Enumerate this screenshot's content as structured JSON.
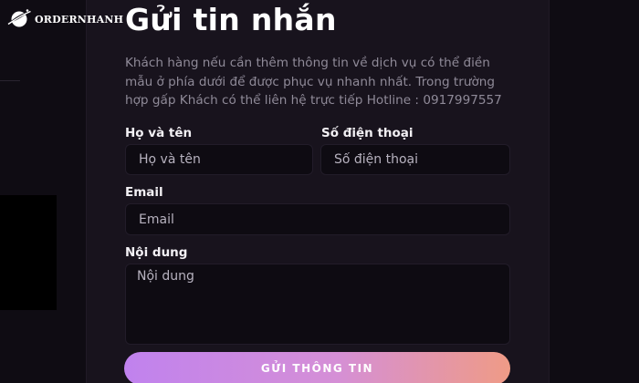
{
  "brand": {
    "name": "ORDERNHANH",
    "logo_icon": "planet-orbit-icon"
  },
  "form": {
    "title": "Gửi tin nhắn",
    "description": "Khách hàng nếu cần thêm thông tin về dịch vụ có thể điền mẫu ở phía dưới để được phục vụ nhanh nhất. Trong trường hợp gấp Khách có thể liên hệ trực tiếp Hotline : 0917997557",
    "fields": {
      "name": {
        "label": "Họ và tên",
        "placeholder": "Họ và tên",
        "value": ""
      },
      "phone": {
        "label": "Số điện thoại",
        "placeholder": "Số điện thoại",
        "value": ""
      },
      "email": {
        "label": "Email",
        "placeholder": "Email",
        "value": ""
      },
      "message": {
        "label": "Nội dung",
        "placeholder": "Nội dung",
        "value": ""
      }
    },
    "submit_label": "GỬI THÔNG TIN"
  },
  "colors": {
    "background": "#0f0c13",
    "panel": "#18131d",
    "input_bg": "#0e0b12",
    "button_gradient_start": "#c082ee",
    "button_gradient_end": "#ef9b86"
  }
}
